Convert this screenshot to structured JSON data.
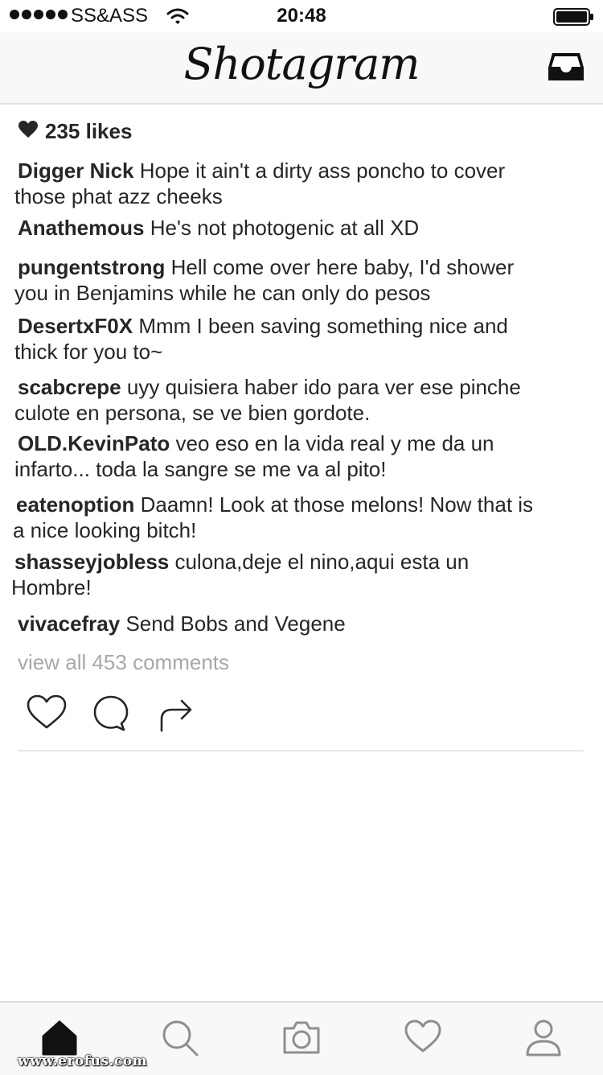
{
  "status_bar": {
    "carrier": "SS&ASS",
    "time": "20:48"
  },
  "header": {
    "logo": "Shotagram",
    "inbox_icon": "inbox-icon"
  },
  "post": {
    "likes": "235 likes",
    "comments": [
      {
        "user": "Digger Nick",
        "lines": [
          "Hope it ain't a dirty ass poncho to cover",
          "those phat azz cheeks"
        ]
      },
      {
        "user": "Anathemous",
        "lines": [
          "He's not photogenic at all XD"
        ]
      },
      {
        "user": "pungentstrong",
        "lines": [
          "Hell come over here baby, I'd shower",
          "you in Benjamins while he can only do pesos"
        ]
      },
      {
        "user": "DesertxF0X",
        "lines": [
          "Mmm I been saving something nice and",
          "thick for you to~"
        ]
      },
      {
        "user": "scabcrepe",
        "lines": [
          "uyy quisiera haber ido para ver ese pinche",
          "culote en persona, se ve bien gordote."
        ]
      },
      {
        "user": "OLD.KevinPato",
        "lines": [
          "veo eso en la vida real y me da un",
          "infarto... toda la sangre se me va al pito!"
        ]
      },
      {
        "user": "eatenoption",
        "lines": [
          "Daamn! Look at those melons! Now that is",
          "a nice looking bitch!"
        ]
      },
      {
        "user": "shasseyjobless",
        "lines": [
          "culona,deje el nino,aqui esta un",
          "Hombre!"
        ]
      },
      {
        "user": "vivacefray",
        "lines": [
          " Send Bobs and Vegene"
        ]
      }
    ],
    "view_all": "view all 453 comments"
  },
  "tab_bar": {
    "items": [
      "home-icon",
      "search-icon",
      "camera-icon",
      "heart-icon",
      "profile-icon"
    ]
  },
  "watermark": "www.erofus.com",
  "colors": {
    "text": "#262626",
    "muted": "#a8a8a8",
    "bar_bg": "#f8f8f8"
  }
}
